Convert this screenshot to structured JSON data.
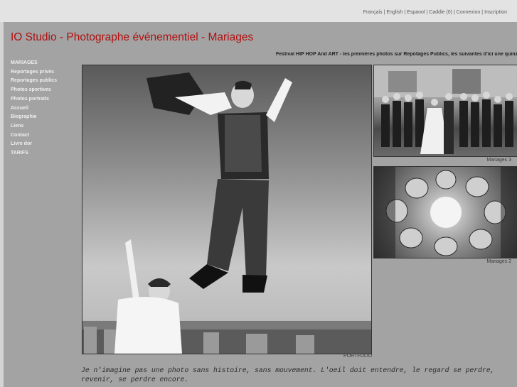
{
  "header": {
    "links": [
      {
        "label": "Français"
      },
      {
        "label": "English"
      },
      {
        "label": "Espanol"
      },
      {
        "label": "Caddie (0)"
      },
      {
        "label": "Connexion"
      },
      {
        "label": "Inscription"
      }
    ]
  },
  "page": {
    "title": "IO Studio - Photographe événementiel - Mariages"
  },
  "nav": {
    "items": [
      {
        "label": "MARIAGES"
      },
      {
        "label": "Reportages privés"
      },
      {
        "label": "Reportages publics"
      },
      {
        "label": "Photos sportives"
      },
      {
        "label": "Photos portraits"
      },
      {
        "label": "Accueil"
      },
      {
        "label": "Biographie"
      },
      {
        "label": "Liens"
      },
      {
        "label": "Contact"
      },
      {
        "label": "Livre dor"
      },
      {
        "label": "TARIFS"
      }
    ]
  },
  "news_ticker": "Festival HIP HOP And ART - les premières photos sur Repotages Publics, les suivantes d'ici une quinz",
  "gallery": {
    "main_caption": "PORTFOLIO",
    "thumbs": [
      {
        "caption": "Mariages 3"
      },
      {
        "caption": "Mariages 2"
      }
    ]
  },
  "quote": "Je n'imagine pas une photo sans histoire, sans mouvement. L'oeil doit entendre, le regard se perdre, revenir, se perdre encore."
}
